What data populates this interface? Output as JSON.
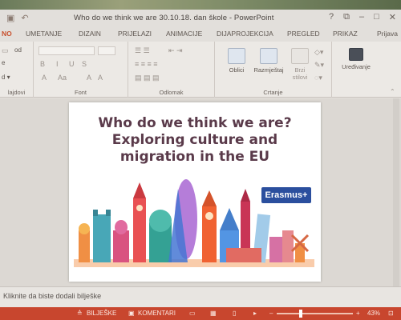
{
  "window": {
    "title": "Who do we think we are 30.10.18. dan škole - PowerPoint",
    "controls": {
      "help": "?",
      "restore_ribbon": "⧉",
      "minimize": "–",
      "maximize": "□",
      "close": "✕"
    },
    "user": "Prijava"
  },
  "tabs": [
    {
      "label": "NO",
      "active": true
    },
    {
      "label": "UMETANJE"
    },
    {
      "label": "DIZAIN"
    },
    {
      "label": "PRIJELAZI"
    },
    {
      "label": "ANIMACIJE"
    },
    {
      "label": "DIJAPROJEKCIJA"
    },
    {
      "label": "PREGLED"
    },
    {
      "label": "PRIKAZ"
    }
  ],
  "ribbon": {
    "groups": {
      "slides": "lajdovi",
      "font": "Font",
      "paragraph": "Odlomak",
      "drawing": "Crtanje",
      "editing": ""
    },
    "buttons": {
      "shapes": "Oblici",
      "arrange": "Razmještaj",
      "quick_styles_1": "Brzi",
      "quick_styles_2": "stilovi",
      "editing": "Uređivanje",
      "layout": "od",
      "reset": "e"
    },
    "font_glyphs": {
      "bold": "B",
      "italic": "I",
      "underline": "U",
      "strike": "S",
      "font_size_up": "A",
      "font_size_down": "A",
      "change_case": "Aa",
      "clear": "A"
    }
  },
  "slide": {
    "title_line1": "Who do we think we are?",
    "title_line2": "Exploring culture and",
    "title_line3": "migration in the EU",
    "badge": "Erasmus+"
  },
  "notes": {
    "placeholder": "Kliknite da biste dodali bilješke"
  },
  "statusbar": {
    "notes_label": "BILJEŠKE",
    "comments_label": "KOMENTARI",
    "zoom_minus": "–",
    "zoom_plus": "+",
    "zoom": "43%"
  },
  "colors": {
    "accent": "#c8462e",
    "title_text": "#5a3a4a",
    "badge": "#2b4f9e"
  }
}
